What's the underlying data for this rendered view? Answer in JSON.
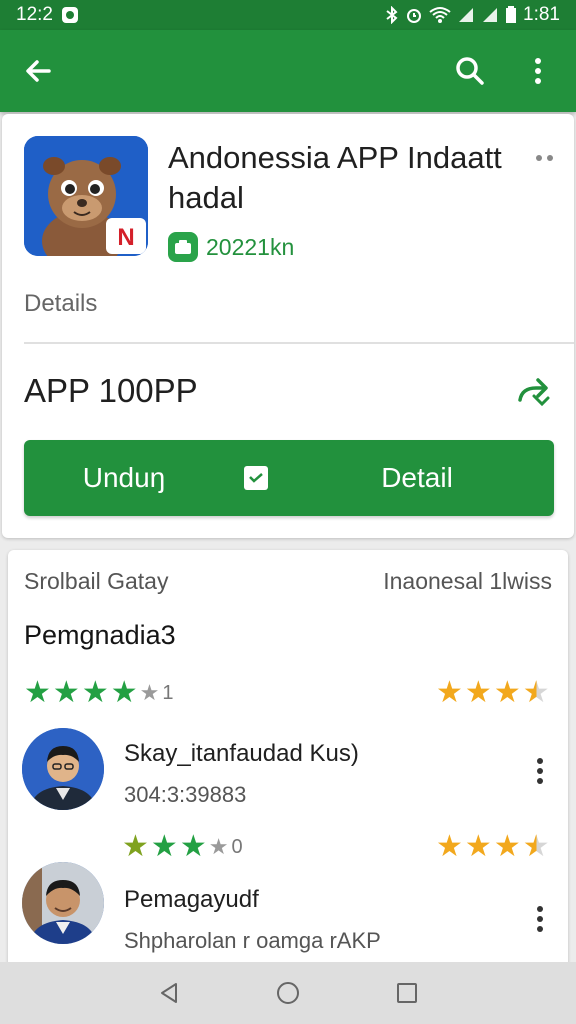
{
  "status_bar": {
    "time_left": "12:2",
    "time_right": "1:81"
  },
  "app_bar": {
    "back_icon": "arrow-left-icon",
    "search_icon": "search-icon",
    "menu_icon": "more-vert-icon"
  },
  "app": {
    "title": "Andonessia APP Indaatt hadal",
    "size": "20221kn",
    "details_label": "Details",
    "price": "APP 100PP",
    "download_label": "Unduŋ",
    "detail_label": "Detail",
    "icon_badge": "N"
  },
  "reviews": {
    "header_left": "Srolbail  Gatay",
    "header_right": "Inaonesal 1lwiss",
    "section_title": "Pemgnadia3",
    "summary_rating_left": {
      "stars": 4,
      "max": 5,
      "count_text": "1"
    },
    "summary_rating_right": {
      "stars": 3.5,
      "max": 5
    },
    "items": [
      {
        "name": "Skay_itanfaudad Kus)",
        "sub": "304:3:39883",
        "rating_left": {
          "stars": 3,
          "count_text": "0"
        },
        "rating_right": {
          "stars": 3.5
        }
      },
      {
        "name": "Pemagayudf",
        "sub": "Shpharolan r oamga rAKP"
      }
    ]
  },
  "colors": {
    "primary": "#22913d",
    "status_bar": "#1e7e34",
    "star_green": "#23a043",
    "star_gold": "#f2a81d"
  }
}
